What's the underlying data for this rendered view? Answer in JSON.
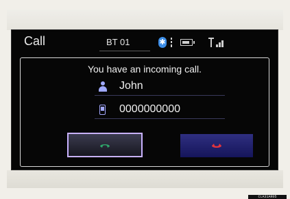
{
  "screen": {
    "title": "Call",
    "device_name": "BT 01",
    "status_icons": [
      "bluetooth-icon",
      "bluetooth-connection-bars-icon",
      "battery-icon",
      "signal-icon"
    ],
    "bluetooth_glyph": "✱"
  },
  "dialog": {
    "message": "You have an incoming call.",
    "caller_name": "John",
    "caller_number": "0000000000",
    "accept_icon": "accept-call-handset-icon",
    "decline_icon": "decline-call-handset-icon",
    "colors": {
      "accept": "#2fa86b",
      "decline": "#e3343d",
      "accent": "#9fa9ff"
    }
  },
  "caption": "CLA31AR05"
}
